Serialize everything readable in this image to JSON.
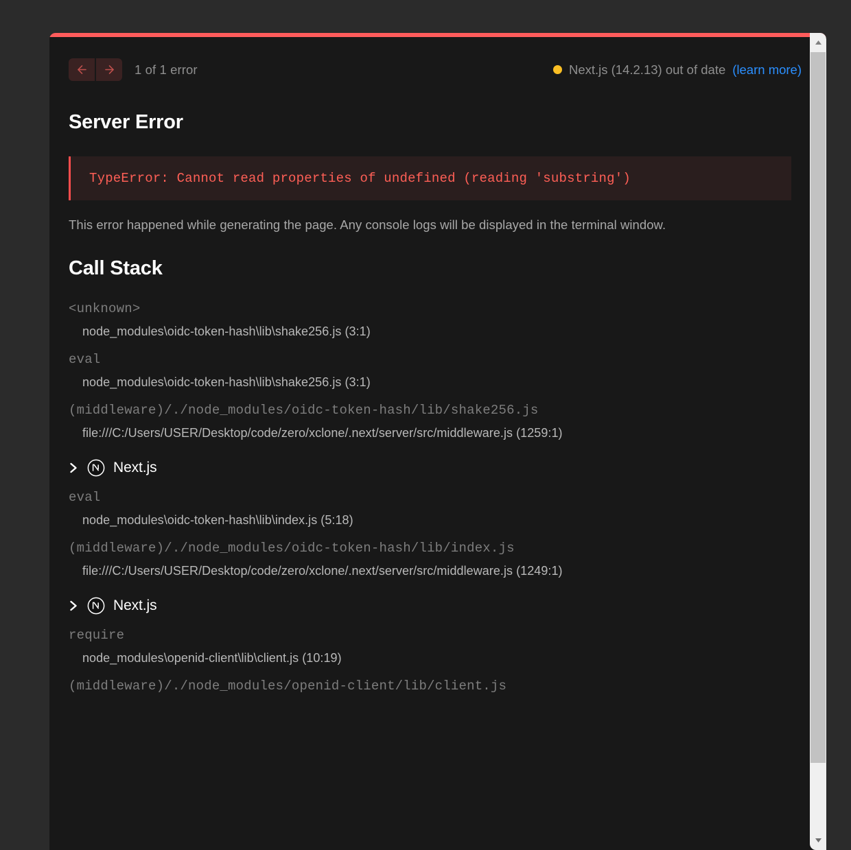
{
  "overlay": {
    "accent_color": "#ff5c5c",
    "background": "#181818",
    "page_background": "#2b2b2b"
  },
  "header": {
    "prev_button_label": "previous error",
    "next_button_label": "next error",
    "error_count": "1 of 1 error",
    "version_status": {
      "dot_color": "#fbbf24",
      "text": "Next.js (14.2.13) out of date",
      "link_text": "(learn more)",
      "link_color": "#2b8fff"
    }
  },
  "error": {
    "title": "Server Error",
    "message": "TypeError: Cannot read properties of undefined (reading 'substring')",
    "message_color": "#ff5f56",
    "banner_background": "#2a1e1e",
    "description": "This error happened while generating the page. Any console logs will be displayed in the terminal window."
  },
  "call_stack": {
    "title": "Call Stack",
    "entries": [
      {
        "kind": "frame",
        "function": "<unknown>",
        "location": "node_modules\\oidc-token-hash\\lib\\shake256.js (3:1)"
      },
      {
        "kind": "frame",
        "function": "eval",
        "location": "node_modules\\oidc-token-hash\\lib\\shake256.js (3:1)"
      },
      {
        "kind": "frame",
        "function": "(middleware)/./node_modules/oidc-token-hash/lib/shake256.js",
        "location": "file:///C:/Users/USER/Desktop/code/zero/xclone/.next/server/src/middleware.js (1259:1)"
      },
      {
        "kind": "group",
        "label": "Next.js",
        "expanded": false
      },
      {
        "kind": "frame",
        "function": "eval",
        "location": "node_modules\\oidc-token-hash\\lib\\index.js (5:18)"
      },
      {
        "kind": "frame",
        "function": "(middleware)/./node_modules/oidc-token-hash/lib/index.js",
        "location": "file:///C:/Users/USER/Desktop/code/zero/xclone/.next/server/src/middleware.js (1249:1)"
      },
      {
        "kind": "group",
        "label": "Next.js",
        "expanded": false
      },
      {
        "kind": "frame",
        "function": "require",
        "location": "node_modules\\openid-client\\lib\\client.js (10:19)"
      },
      {
        "kind": "frame",
        "function": "(middleware)/./node_modules/openid-client/lib/client.js",
        "location": ""
      }
    ]
  },
  "scrollbar": {
    "up_arrow": "scroll-up",
    "down_arrow": "scroll-down",
    "thumb_color": "#c2c2c2",
    "track_color": "#f0f0f0"
  }
}
